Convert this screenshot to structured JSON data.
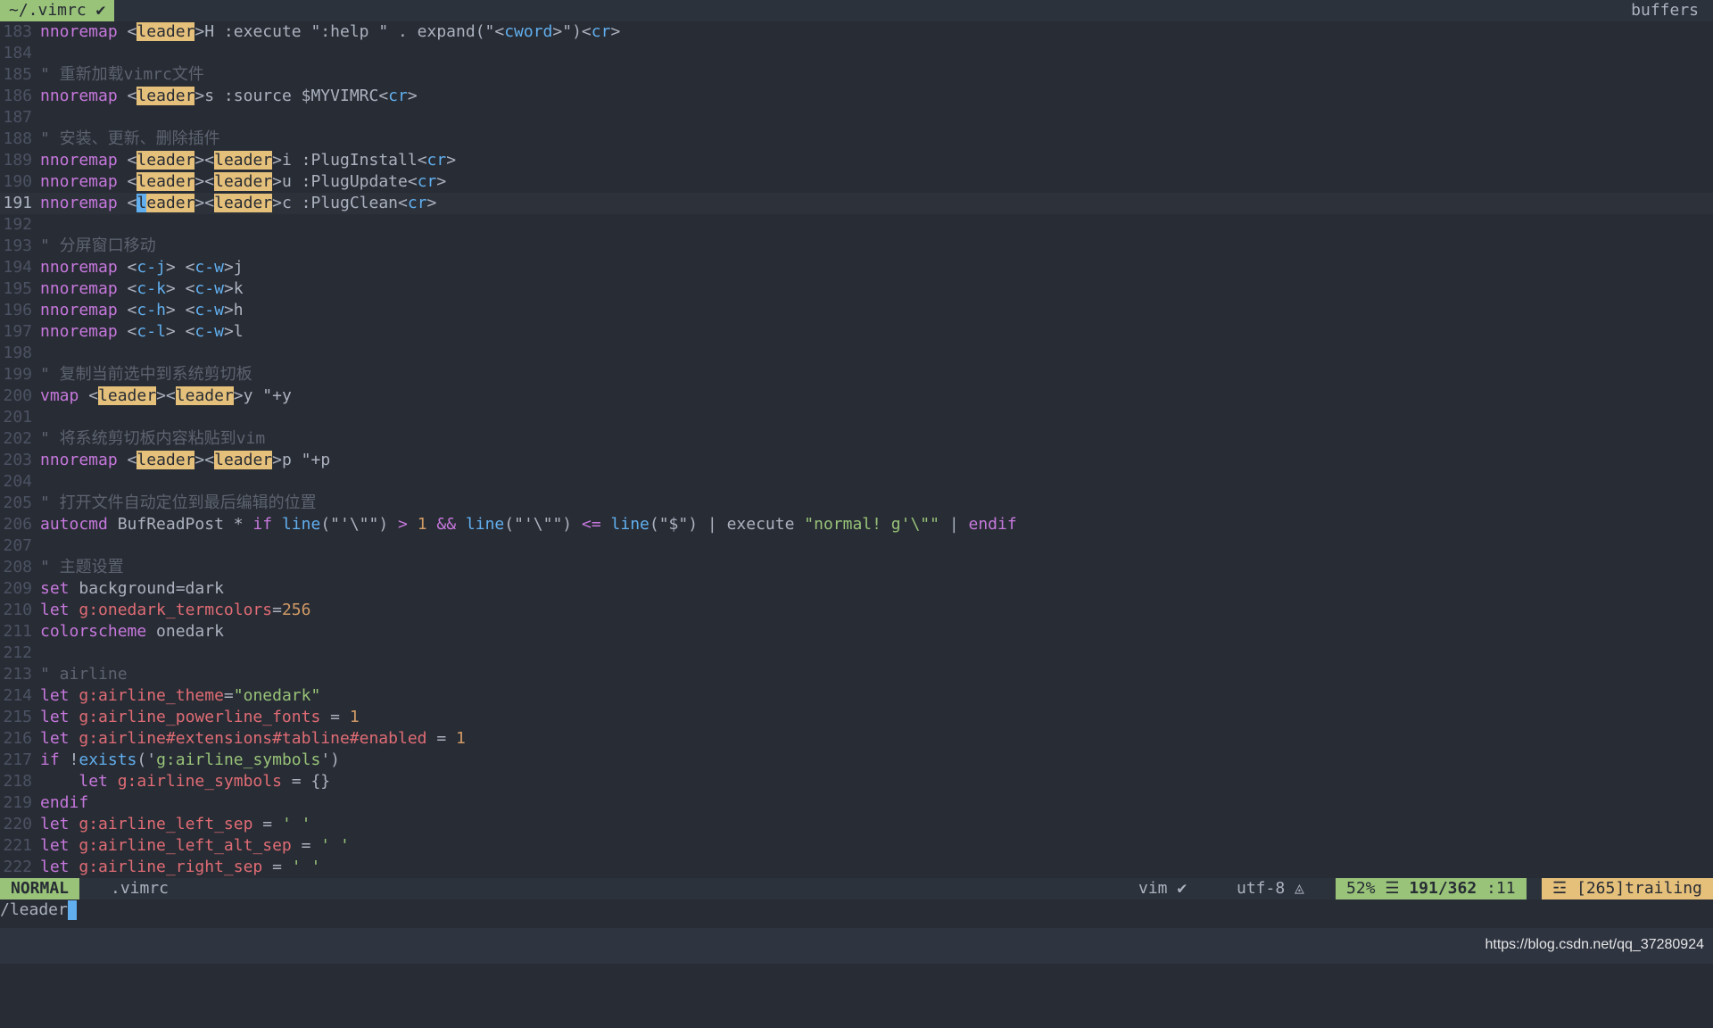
{
  "tabline": {
    "active_tab": "~/.vimrc",
    "right_label": "buffers"
  },
  "lines": [
    {
      "n": "183",
      "segs": [
        [
          "k",
          "nnoremap"
        ],
        [
          "pu",
          " <"
        ],
        [
          "hl",
          "leader"
        ],
        [
          "pu",
          ">H :execute \":help \" . expand(\"<"
        ],
        [
          "b",
          "cword"
        ],
        [
          "pu",
          ">\")<"
        ],
        [
          "b",
          "cr"
        ],
        [
          "pu",
          ">"
        ]
      ]
    },
    {
      "n": "184",
      "segs": []
    },
    {
      "n": "185",
      "segs": [
        [
          "c",
          "\" 重新加载vimrc文件"
        ]
      ]
    },
    {
      "n": "186",
      "segs": [
        [
          "k",
          "nnoremap"
        ],
        [
          "pu",
          " <"
        ],
        [
          "hl",
          "leader"
        ],
        [
          "pu",
          ">s :source $MYVIMRC<"
        ],
        [
          "b",
          "cr"
        ],
        [
          "pu",
          ">"
        ]
      ]
    },
    {
      "n": "187",
      "segs": []
    },
    {
      "n": "188",
      "segs": [
        [
          "c",
          "\" 安装、更新、删除插件"
        ]
      ]
    },
    {
      "n": "189",
      "segs": [
        [
          "k",
          "nnoremap"
        ],
        [
          "pu",
          " <"
        ],
        [
          "hl",
          "leader"
        ],
        [
          "pu",
          "><"
        ],
        [
          "hl",
          "leader"
        ],
        [
          "pu",
          ">i :PlugInstall<"
        ],
        [
          "b",
          "cr"
        ],
        [
          "pu",
          ">"
        ]
      ]
    },
    {
      "n": "190",
      "segs": [
        [
          "k",
          "nnoremap"
        ],
        [
          "pu",
          " <"
        ],
        [
          "hl",
          "leader"
        ],
        [
          "pu",
          "><"
        ],
        [
          "hl",
          "leader"
        ],
        [
          "pu",
          ">u :PlugUpdate<"
        ],
        [
          "b",
          "cr"
        ],
        [
          "pu",
          ">"
        ]
      ]
    },
    {
      "n": "191",
      "cur": true,
      "segs": [
        [
          "k",
          "nnoremap"
        ],
        [
          "pu",
          " <"
        ],
        [
          "cursor",
          "l"
        ],
        [
          "hl",
          "eader"
        ],
        [
          "pu",
          "><"
        ],
        [
          "hl",
          "leader"
        ],
        [
          "pu",
          ">c :PlugClean<"
        ],
        [
          "b",
          "cr"
        ],
        [
          "pu",
          ">"
        ]
      ]
    },
    {
      "n": "192",
      "segs": []
    },
    {
      "n": "193",
      "segs": [
        [
          "c",
          "\" 分屏窗口移动"
        ]
      ]
    },
    {
      "n": "194",
      "segs": [
        [
          "k",
          "nnoremap"
        ],
        [
          "pu",
          " <"
        ],
        [
          "b",
          "c-j"
        ],
        [
          "pu",
          "> <"
        ],
        [
          "b",
          "c-w"
        ],
        [
          "pu",
          ">j"
        ]
      ]
    },
    {
      "n": "195",
      "segs": [
        [
          "k",
          "nnoremap"
        ],
        [
          "pu",
          " <"
        ],
        [
          "b",
          "c-k"
        ],
        [
          "pu",
          "> <"
        ],
        [
          "b",
          "c-w"
        ],
        [
          "pu",
          ">k"
        ]
      ]
    },
    {
      "n": "196",
      "segs": [
        [
          "k",
          "nnoremap"
        ],
        [
          "pu",
          " <"
        ],
        [
          "b",
          "c-h"
        ],
        [
          "pu",
          "> <"
        ],
        [
          "b",
          "c-w"
        ],
        [
          "pu",
          ">h"
        ]
      ]
    },
    {
      "n": "197",
      "segs": [
        [
          "k",
          "nnoremap"
        ],
        [
          "pu",
          " <"
        ],
        [
          "b",
          "c-l"
        ],
        [
          "pu",
          "> <"
        ],
        [
          "b",
          "c-w"
        ],
        [
          "pu",
          ">l"
        ]
      ]
    },
    {
      "n": "198",
      "segs": []
    },
    {
      "n": "199",
      "segs": [
        [
          "c",
          "\" 复制当前选中到系统剪切板"
        ]
      ]
    },
    {
      "n": "200",
      "segs": [
        [
          "k",
          "vmap"
        ],
        [
          "pu",
          " <"
        ],
        [
          "hl",
          "leader"
        ],
        [
          "pu",
          "><"
        ],
        [
          "hl",
          "leader"
        ],
        [
          "pu",
          ">y \"+y"
        ]
      ]
    },
    {
      "n": "201",
      "segs": []
    },
    {
      "n": "202",
      "segs": [
        [
          "c",
          "\" 将系统剪切板内容粘贴到vim"
        ]
      ]
    },
    {
      "n": "203",
      "segs": [
        [
          "k",
          "nnoremap"
        ],
        [
          "pu",
          " <"
        ],
        [
          "hl",
          "leader"
        ],
        [
          "pu",
          "><"
        ],
        [
          "hl",
          "leader"
        ],
        [
          "pu",
          ">p \"+p"
        ]
      ]
    },
    {
      "n": "204",
      "segs": []
    },
    {
      "n": "205",
      "segs": [
        [
          "c",
          "\" 打开文件自动定位到最后编辑的位置"
        ]
      ]
    },
    {
      "n": "206",
      "segs": [
        [
          "k",
          "autocmd"
        ],
        [
          "pu",
          " BufReadPost * "
        ],
        [
          "k",
          "if"
        ],
        [
          "pu",
          " "
        ],
        [
          "f",
          "line"
        ],
        [
          "pu",
          "(\"'\\\"\") "
        ],
        [
          "k",
          ">"
        ],
        [
          "pu",
          " "
        ],
        [
          "num",
          "1"
        ],
        [
          "pu",
          " "
        ],
        [
          "k",
          "&&"
        ],
        [
          "pu",
          " "
        ],
        [
          "f",
          "line"
        ],
        [
          "pu",
          "(\"'\\\"\") "
        ],
        [
          "k",
          "<="
        ],
        [
          "pu",
          " "
        ],
        [
          "f",
          "line"
        ],
        [
          "pu",
          "(\"$\") | execute "
        ],
        [
          "s",
          "\"normal! g'\\\"\""
        ],
        [
          "pu",
          " | "
        ],
        [
          "k",
          "endif"
        ]
      ]
    },
    {
      "n": "207",
      "segs": []
    },
    {
      "n": "208",
      "segs": [
        [
          "c",
          "\" 主题设置"
        ]
      ]
    },
    {
      "n": "209",
      "segs": [
        [
          "k",
          "set"
        ],
        [
          "pu",
          " background=dark"
        ]
      ]
    },
    {
      "n": "210",
      "segs": [
        [
          "k",
          "let"
        ],
        [
          "pu",
          " "
        ],
        [
          "n",
          "g:onedark_termcolors"
        ],
        [
          "pu",
          "="
        ],
        [
          "num",
          "256"
        ]
      ]
    },
    {
      "n": "211",
      "segs": [
        [
          "k",
          "colorscheme"
        ],
        [
          "pu",
          " onedark"
        ]
      ]
    },
    {
      "n": "212",
      "segs": []
    },
    {
      "n": "213",
      "segs": [
        [
          "c",
          "\" airline"
        ]
      ]
    },
    {
      "n": "214",
      "segs": [
        [
          "k",
          "let"
        ],
        [
          "pu",
          " "
        ],
        [
          "n",
          "g:airline_theme"
        ],
        [
          "pu",
          "="
        ],
        [
          "s",
          "\"onedark\""
        ]
      ]
    },
    {
      "n": "215",
      "segs": [
        [
          "k",
          "let"
        ],
        [
          "pu",
          " "
        ],
        [
          "n",
          "g:airline_powerline_fonts"
        ],
        [
          "pu",
          " = "
        ],
        [
          "num",
          "1"
        ]
      ]
    },
    {
      "n": "216",
      "segs": [
        [
          "k",
          "let"
        ],
        [
          "pu",
          " "
        ],
        [
          "n",
          "g:airline#extensions#tabline#enabled"
        ],
        [
          "pu",
          " = "
        ],
        [
          "num",
          "1"
        ]
      ]
    },
    {
      "n": "217",
      "segs": [
        [
          "k",
          "if"
        ],
        [
          "pu",
          " !"
        ],
        [
          "f",
          "exists"
        ],
        [
          "pu",
          "('"
        ],
        [
          "s",
          "g:airline_symbols"
        ],
        [
          "pu",
          "')"
        ]
      ]
    },
    {
      "n": "218",
      "segs": [
        [
          "pu",
          "    "
        ],
        [
          "k",
          "let"
        ],
        [
          "pu",
          " "
        ],
        [
          "n",
          "g:airline_symbols"
        ],
        [
          "pu",
          " = {}"
        ]
      ]
    },
    {
      "n": "219",
      "segs": [
        [
          "k",
          "endif"
        ]
      ]
    },
    {
      "n": "220",
      "segs": [
        [
          "k",
          "let"
        ],
        [
          "pu",
          " "
        ],
        [
          "n",
          "g:airline_left_sep"
        ],
        [
          "pu",
          " = "
        ],
        [
          "s",
          "' '"
        ]
      ]
    },
    {
      "n": "221",
      "segs": [
        [
          "k",
          "let"
        ],
        [
          "pu",
          " "
        ],
        [
          "n",
          "g:airline_left_alt_sep"
        ],
        [
          "pu",
          " = "
        ],
        [
          "s",
          "' '"
        ]
      ]
    },
    {
      "n": "222",
      "segs": [
        [
          "k",
          "let"
        ],
        [
          "pu",
          " "
        ],
        [
          "n",
          "g:airline_right_sep"
        ],
        [
          "pu",
          " = "
        ],
        [
          "s",
          "' '"
        ]
      ]
    }
  ],
  "statusline": {
    "mode": "NORMAL",
    "filename": ".vimrc",
    "filetype": "vim",
    "encoding": "utf-8",
    "percent": "52%",
    "line_pos": "191/362",
    "col": ":11",
    "warning": "[265]trailing"
  },
  "cmdline": "/leader",
  "watermark": "https://blog.csdn.net/qq_37280924"
}
